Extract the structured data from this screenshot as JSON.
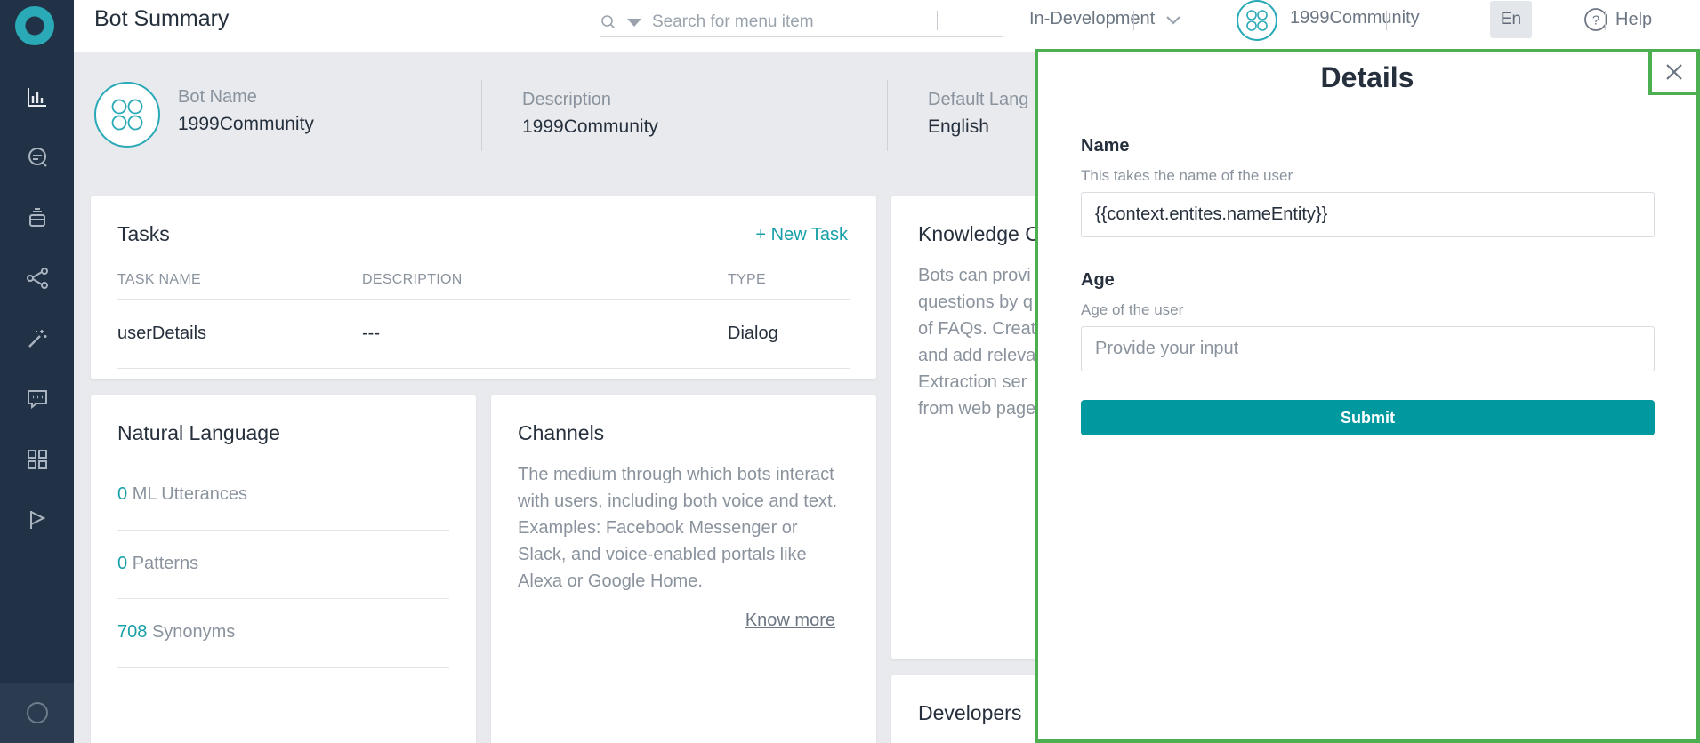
{
  "header": {
    "title": "Bot Summary",
    "search_placeholder": "Search for menu item",
    "environment": "In-Development",
    "bot_name": "1999Community",
    "language": "En",
    "help": "Help"
  },
  "bot_info": {
    "name_label": "Bot Name",
    "name_value": "1999Community",
    "description_label": "Description",
    "description_value": "1999Community",
    "language_label": "Default Lang",
    "language_value": "English"
  },
  "tasks": {
    "title": "Tasks",
    "new_task": "+ New Task",
    "columns": [
      "TASK NAME",
      "DESCRIPTION",
      "TYPE"
    ],
    "rows": [
      {
        "name": "userDetails",
        "description": "---",
        "type": "Dialog"
      }
    ]
  },
  "knowledge": {
    "title": "Knowledge C",
    "lines": [
      "Bots can provi",
      "questions by q",
      "of FAQs. Creat",
      "and add releva",
      "Extraction ser",
      "from web page"
    ]
  },
  "natural_language": {
    "title": "Natural Language",
    "items": [
      {
        "count": "0",
        "label": "ML Utterances"
      },
      {
        "count": "0",
        "label": "Patterns"
      },
      {
        "count": "708",
        "label": "Synonyms"
      }
    ]
  },
  "channels": {
    "title": "Channels",
    "lines": [
      "The medium through which bots interact",
      "with users, including both voice and text.",
      "Examples: Facebook Messenger or",
      "Slack, and voice-enabled portals like",
      "Alexa or Google Home."
    ],
    "link": "Know more"
  },
  "developers": {
    "title": "Developers"
  },
  "details_panel": {
    "title": "Details",
    "fields": [
      {
        "label": "Name",
        "hint": "This takes the name of the user",
        "value": "{{context.entites.nameEntity}}",
        "placeholder": ""
      },
      {
        "label": "Age",
        "hint": "Age of the user",
        "value": "",
        "placeholder": "Provide your input"
      }
    ],
    "submit": "Submit"
  },
  "colors": {
    "accent": "#18a0a8",
    "sidebar": "#223246",
    "highlight": "#4caf50",
    "submit": "#00999f"
  }
}
